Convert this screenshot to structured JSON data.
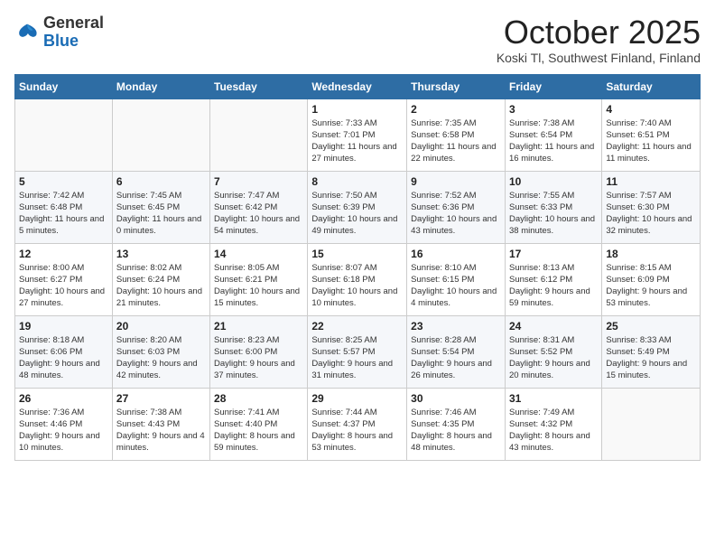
{
  "header": {
    "logo_line1": "General",
    "logo_line2": "Blue",
    "month": "October 2025",
    "location": "Koski Tl, Southwest Finland, Finland"
  },
  "days_of_week": [
    "Sunday",
    "Monday",
    "Tuesday",
    "Wednesday",
    "Thursday",
    "Friday",
    "Saturday"
  ],
  "weeks": [
    [
      {
        "day": "",
        "info": ""
      },
      {
        "day": "",
        "info": ""
      },
      {
        "day": "",
        "info": ""
      },
      {
        "day": "1",
        "info": "Sunrise: 7:33 AM\nSunset: 7:01 PM\nDaylight: 11 hours and 27 minutes."
      },
      {
        "day": "2",
        "info": "Sunrise: 7:35 AM\nSunset: 6:58 PM\nDaylight: 11 hours and 22 minutes."
      },
      {
        "day": "3",
        "info": "Sunrise: 7:38 AM\nSunset: 6:54 PM\nDaylight: 11 hours and 16 minutes."
      },
      {
        "day": "4",
        "info": "Sunrise: 7:40 AM\nSunset: 6:51 PM\nDaylight: 11 hours and 11 minutes."
      }
    ],
    [
      {
        "day": "5",
        "info": "Sunrise: 7:42 AM\nSunset: 6:48 PM\nDaylight: 11 hours and 5 minutes."
      },
      {
        "day": "6",
        "info": "Sunrise: 7:45 AM\nSunset: 6:45 PM\nDaylight: 11 hours and 0 minutes."
      },
      {
        "day": "7",
        "info": "Sunrise: 7:47 AM\nSunset: 6:42 PM\nDaylight: 10 hours and 54 minutes."
      },
      {
        "day": "8",
        "info": "Sunrise: 7:50 AM\nSunset: 6:39 PM\nDaylight: 10 hours and 49 minutes."
      },
      {
        "day": "9",
        "info": "Sunrise: 7:52 AM\nSunset: 6:36 PM\nDaylight: 10 hours and 43 minutes."
      },
      {
        "day": "10",
        "info": "Sunrise: 7:55 AM\nSunset: 6:33 PM\nDaylight: 10 hours and 38 minutes."
      },
      {
        "day": "11",
        "info": "Sunrise: 7:57 AM\nSunset: 6:30 PM\nDaylight: 10 hours and 32 minutes."
      }
    ],
    [
      {
        "day": "12",
        "info": "Sunrise: 8:00 AM\nSunset: 6:27 PM\nDaylight: 10 hours and 27 minutes."
      },
      {
        "day": "13",
        "info": "Sunrise: 8:02 AM\nSunset: 6:24 PM\nDaylight: 10 hours and 21 minutes."
      },
      {
        "day": "14",
        "info": "Sunrise: 8:05 AM\nSunset: 6:21 PM\nDaylight: 10 hours and 15 minutes."
      },
      {
        "day": "15",
        "info": "Sunrise: 8:07 AM\nSunset: 6:18 PM\nDaylight: 10 hours and 10 minutes."
      },
      {
        "day": "16",
        "info": "Sunrise: 8:10 AM\nSunset: 6:15 PM\nDaylight: 10 hours and 4 minutes."
      },
      {
        "day": "17",
        "info": "Sunrise: 8:13 AM\nSunset: 6:12 PM\nDaylight: 9 hours and 59 minutes."
      },
      {
        "day": "18",
        "info": "Sunrise: 8:15 AM\nSunset: 6:09 PM\nDaylight: 9 hours and 53 minutes."
      }
    ],
    [
      {
        "day": "19",
        "info": "Sunrise: 8:18 AM\nSunset: 6:06 PM\nDaylight: 9 hours and 48 minutes."
      },
      {
        "day": "20",
        "info": "Sunrise: 8:20 AM\nSunset: 6:03 PM\nDaylight: 9 hours and 42 minutes."
      },
      {
        "day": "21",
        "info": "Sunrise: 8:23 AM\nSunset: 6:00 PM\nDaylight: 9 hours and 37 minutes."
      },
      {
        "day": "22",
        "info": "Sunrise: 8:25 AM\nSunset: 5:57 PM\nDaylight: 9 hours and 31 minutes."
      },
      {
        "day": "23",
        "info": "Sunrise: 8:28 AM\nSunset: 5:54 PM\nDaylight: 9 hours and 26 minutes."
      },
      {
        "day": "24",
        "info": "Sunrise: 8:31 AM\nSunset: 5:52 PM\nDaylight: 9 hours and 20 minutes."
      },
      {
        "day": "25",
        "info": "Sunrise: 8:33 AM\nSunset: 5:49 PM\nDaylight: 9 hours and 15 minutes."
      }
    ],
    [
      {
        "day": "26",
        "info": "Sunrise: 7:36 AM\nSunset: 4:46 PM\nDaylight: 9 hours and 10 minutes."
      },
      {
        "day": "27",
        "info": "Sunrise: 7:38 AM\nSunset: 4:43 PM\nDaylight: 9 hours and 4 minutes."
      },
      {
        "day": "28",
        "info": "Sunrise: 7:41 AM\nSunset: 4:40 PM\nDaylight: 8 hours and 59 minutes."
      },
      {
        "day": "29",
        "info": "Sunrise: 7:44 AM\nSunset: 4:37 PM\nDaylight: 8 hours and 53 minutes."
      },
      {
        "day": "30",
        "info": "Sunrise: 7:46 AM\nSunset: 4:35 PM\nDaylight: 8 hours and 48 minutes."
      },
      {
        "day": "31",
        "info": "Sunrise: 7:49 AM\nSunset: 4:32 PM\nDaylight: 8 hours and 43 minutes."
      },
      {
        "day": "",
        "info": ""
      }
    ]
  ]
}
